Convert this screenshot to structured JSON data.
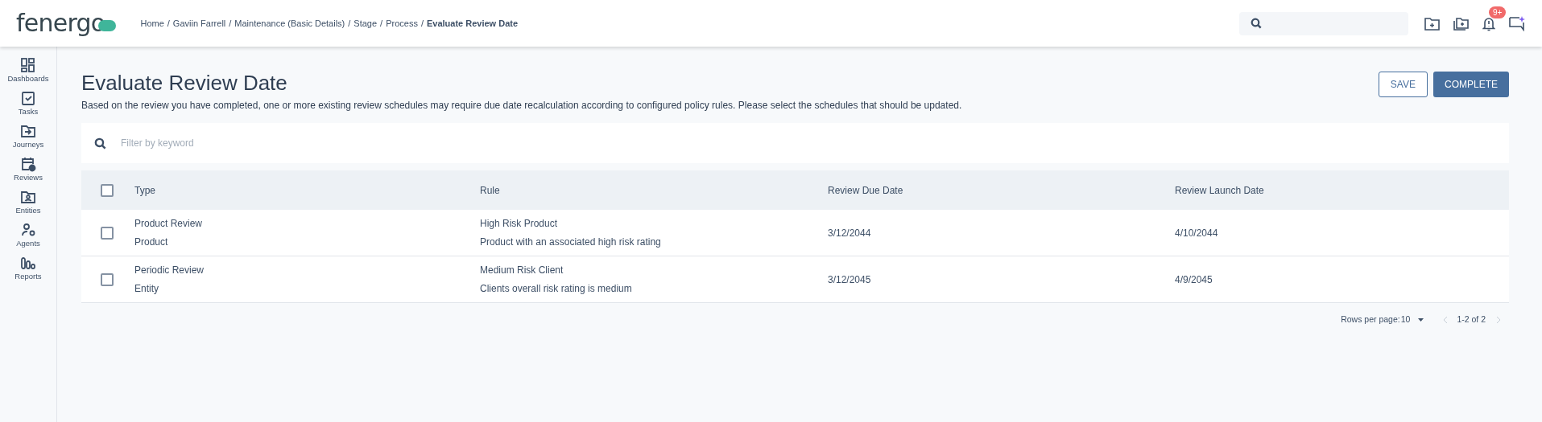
{
  "header": {
    "logo": "fenergo",
    "breadcrumbs": [
      "Home",
      "Gaviin Farrell",
      "Maintenance (Basic Details)",
      "Stage",
      "Process"
    ],
    "separator": "/",
    "current": "Evaluate Review Date",
    "notification_badge": "9+"
  },
  "sidebar": {
    "items": [
      {
        "label": "Dashboards"
      },
      {
        "label": "Tasks"
      },
      {
        "label": "Journeys"
      },
      {
        "label": "Reviews"
      },
      {
        "label": "Entities"
      },
      {
        "label": "Agents"
      },
      {
        "label": "Reports"
      }
    ]
  },
  "page": {
    "title": "Evaluate Review Date",
    "description": "Based on the review you have completed, one or more existing review schedules may require due date recalculation according to configured policy rules. Please select the schedules that should be updated.",
    "buttons": [
      {
        "label": "SAVE",
        "kind": "outline"
      },
      {
        "label": "COMPLETE",
        "kind": "primary"
      }
    ]
  },
  "filter": {
    "placeholder": "Filter by keyword"
  },
  "table": {
    "all_checked": false,
    "columns": [
      "Type",
      "Rule",
      "Review Due Date",
      "Review Launch Date"
    ],
    "rows": [
      {
        "checked": false,
        "type": "Product Review",
        "subtype": "Product",
        "rule": "High Risk Product",
        "rule_detail": "Product with an associated high risk rating",
        "due": "3/12/2044",
        "launch": "4/10/2044"
      },
      {
        "checked": false,
        "type": "Periodic Review",
        "subtype": "Entity",
        "rule": "Medium Risk Client",
        "rule_detail": "Clients overall risk rating is medium",
        "due": "3/12/2045",
        "launch": "4/9/2045"
      }
    ]
  },
  "pagination": {
    "rows_per_page_label": "Rows per page:",
    "rows_per_page": "10",
    "range": "1-2 of 2"
  }
}
